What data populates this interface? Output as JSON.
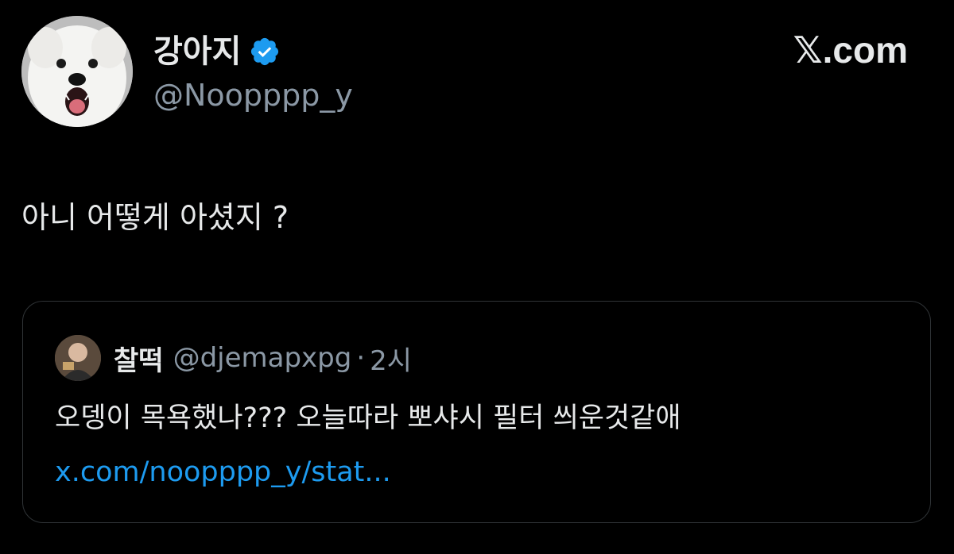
{
  "author": {
    "display_name": "강아지",
    "handle": "@Noopppp_y",
    "verified": true,
    "avatar_icon": "white-dog-avatar"
  },
  "brand": {
    "label": "𝕏.com"
  },
  "tweet": {
    "text": "아니 어떻게 아셨지 ?"
  },
  "quote": {
    "display_name": "찰떡",
    "handle": "@djemapxpg",
    "separator": "·",
    "time": "2시",
    "text": "오뎅이 목욕했나??? 오늘따라 뽀샤시 필터 씌운것같애",
    "link": "x.com/noopppp_y/stat...",
    "avatar_icon": "quote-user-avatar"
  },
  "colors": {
    "background": "#000000",
    "text_primary": "#e7e9ea",
    "text_secondary": "#8b98a5",
    "link": "#1d9bf0",
    "verified": "#1d9bf0",
    "border": "#2f3336"
  }
}
